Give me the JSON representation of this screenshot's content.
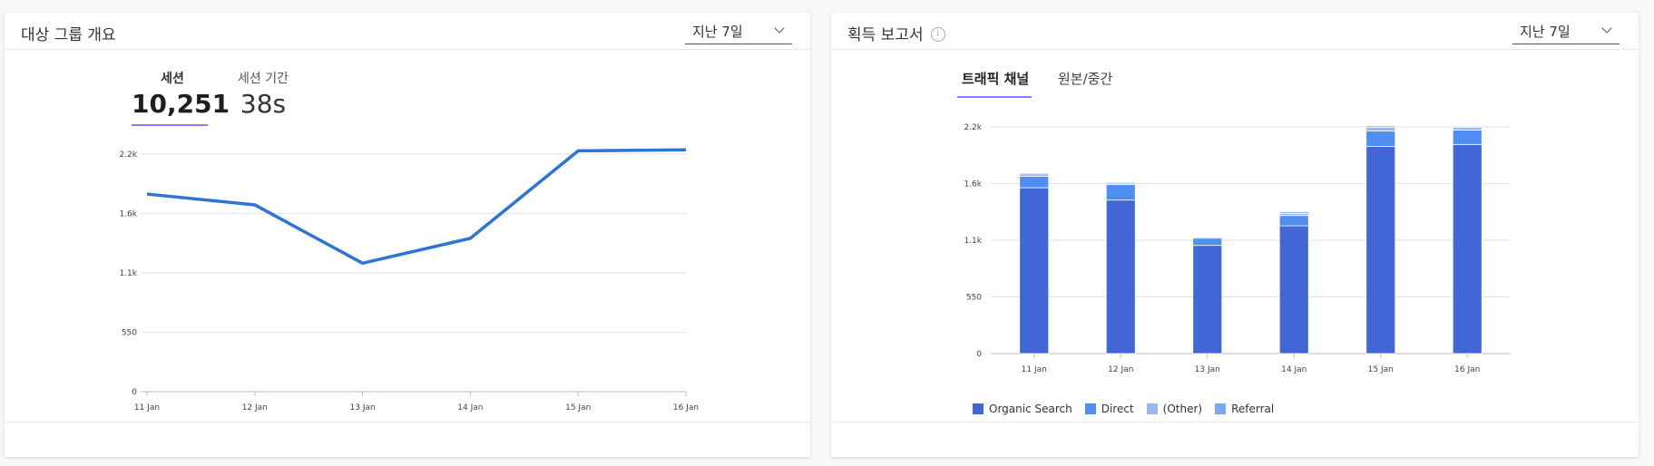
{
  "audience_card": {
    "title": "대상 그룹 개요",
    "range_selector": "지난 7일",
    "metrics": [
      {
        "label": "세션",
        "value": "10,251",
        "active": true
      },
      {
        "label": "세션 기간",
        "value": "38s",
        "active": false
      }
    ]
  },
  "acquisition_card": {
    "title": "획득 보고서",
    "info_icon": "i",
    "range_selector": "지난 7일",
    "tabs": [
      {
        "label": "트래픽 채널",
        "active": true
      },
      {
        "label": "원본/중간",
        "active": false
      }
    ]
  },
  "chart_data": [
    {
      "type": "line",
      "x": [
        "11 Jan",
        "12 Jan",
        "13 Jan",
        "14 Jan",
        "15 Jan",
        "16 Jan"
      ],
      "series": [
        {
          "values": [
            1830,
            1730,
            1190,
            1420,
            2230,
            2240
          ],
          "color": "#2d74d4"
        }
      ],
      "yticks": [
        "0",
        "550",
        "1.1k",
        "1.6k",
        "2.2k"
      ],
      "ytick_values": [
        0,
        550,
        1100,
        1650,
        2200
      ],
      "ylim": [
        0,
        2200
      ],
      "grid": true
    },
    {
      "type": "bar",
      "stacked": true,
      "categories": [
        "11 Jan",
        "12 Jan",
        "13 Jan",
        "14 Jan",
        "15 Jan",
        "16 Jan"
      ],
      "series": [
        {
          "name": "Organic Search",
          "color": "#4167d6",
          "values": [
            1610,
            1490,
            1050,
            1240,
            2010,
            2030
          ]
        },
        {
          "name": "Direct",
          "color": "#4d8ef0",
          "values": [
            110,
            150,
            70,
            100,
            150,
            140
          ]
        },
        {
          "name": "(Other)",
          "color": "#9ab7ee",
          "values": [
            25,
            15,
            0,
            20,
            35,
            25
          ]
        },
        {
          "name": "Referral",
          "color": "#79a8f6",
          "values": [
            10,
            10,
            10,
            15,
            15,
            10
          ]
        }
      ],
      "yticks": [
        "0",
        "550",
        "1.1k",
        "1.6k",
        "2.2k"
      ],
      "ytick_values": [
        0,
        550,
        1100,
        1650,
        2200
      ],
      "ylim": [
        0,
        2200
      ],
      "grid": true,
      "legend": "bottom-left"
    }
  ]
}
